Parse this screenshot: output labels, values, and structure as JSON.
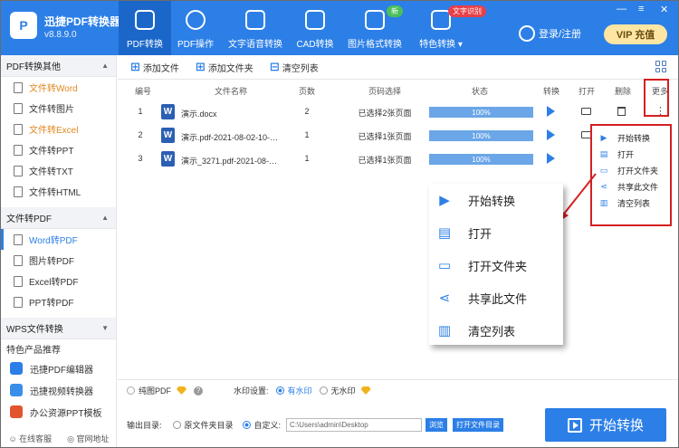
{
  "app": {
    "logo_text": "P",
    "title": "迅捷PDF转换器",
    "version": "v8.8.9.0"
  },
  "nav": [
    {
      "label": "PDF转换",
      "active": true
    },
    {
      "label": "PDF操作"
    },
    {
      "label": "文字语音转换"
    },
    {
      "label": "CAD转换"
    },
    {
      "label": "图片格式转换",
      "badge": "新"
    },
    {
      "label": "特色转换 ▾",
      "badge": "文字识别"
    }
  ],
  "header": {
    "login_label": "登录/注册",
    "vip_label": "VIP 充值",
    "minimize": "—",
    "close": "✕"
  },
  "sidebar": {
    "section_pdf_convert": "PDF转换其他",
    "pdf_convert_items": [
      "文件转Word",
      "文件转图片",
      "文件转Excel",
      "文件转PPT",
      "文件转TXT",
      "文件转HTML"
    ],
    "section_to_pdf": "文件转PDF",
    "to_pdf_items": [
      "Word转PDF",
      "图片转PDF",
      "Excel转PDF",
      "PPT转PDF"
    ],
    "section_wps": "WPS文件转换",
    "products_title": "特色产品推荐",
    "products": [
      "迅捷PDF编辑器",
      "迅捷视频转换器",
      "办公资源PPT模板"
    ],
    "footer_service": "在线客服",
    "footer_website": "官网地址"
  },
  "toolbar": {
    "add_file": "添加文件",
    "add_folder": "添加文件夹",
    "clear_list": "清空列表"
  },
  "table": {
    "headers": {
      "no": "编号",
      "name": "文件名称",
      "pages": "页数",
      "page_select": "页码选择",
      "status": "状态",
      "convert": "转换",
      "open": "打开",
      "delete": "删除",
      "more": "更多"
    },
    "rows": [
      {
        "no": "1",
        "name": "演示.docx",
        "pages": "2",
        "page_select": "已选择2张页面",
        "status": "100%"
      },
      {
        "no": "2",
        "name": "演示.pdf-2021-08-02-10-53...",
        "pages": "1",
        "page_select": "已选择1张页面",
        "status": "100%"
      },
      {
        "no": "3",
        "name": "演示_3271.pdf-2021-08-02-...",
        "pages": "1",
        "page_select": "已选择1张页面",
        "status": "100%"
      }
    ]
  },
  "more_menu": [
    "开始转换",
    "打开",
    "打开文件夹",
    "共享此文件",
    "清空列表"
  ],
  "options": {
    "pure_pdf": "纯图PDF",
    "watermark_label": "水印设置:",
    "with_watermark": "有水印",
    "no_watermark": "无水印"
  },
  "output": {
    "label": "输出目录:",
    "source_dir": "原文件夹目录",
    "custom": "自定义:",
    "path": "C:\\Users\\admin\\Desktop",
    "browse": "浏览",
    "open_dir": "打开文件目录"
  },
  "start_button": "开始转换",
  "colors": {
    "brand": "#2c7fe6",
    "highlight": "#d42020",
    "active_item": "#e08a22"
  }
}
